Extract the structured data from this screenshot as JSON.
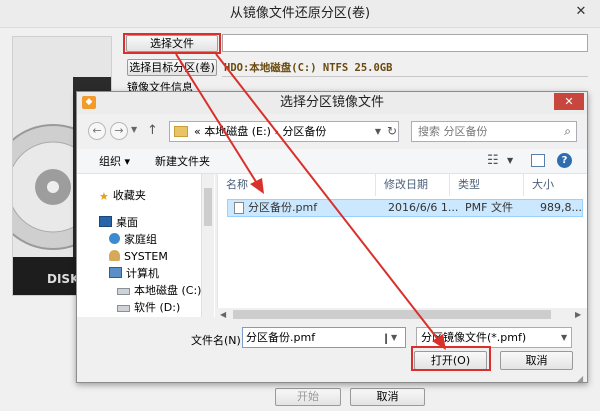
{
  "outer_window": {
    "title": "从镜像文件还原分区(卷)",
    "close_glyph": "✕",
    "select_file_label": "选择文件",
    "file_path_value": "",
    "select_target_label": "选择目标分区(卷)",
    "target_value": "HDO:本地磁盘(C:) NTFS 25.0GB",
    "image_info_label": "镜像文件信息",
    "start_label": "开始",
    "cancel_label": "取消",
    "disk_text": "DISK"
  },
  "dialog": {
    "title": "选择分区镜像文件",
    "close_glyph": "✕",
    "address": {
      "prefix": "«",
      "segments": [
        "本地磁盘 (E:)",
        "分区备份"
      ],
      "separator": "›"
    },
    "search_placeholder": "搜索 分区备份",
    "toolbar": {
      "organize": "组织 ▾",
      "new_folder": "新建文件夹"
    },
    "nav_items": [
      {
        "label": "收藏夹",
        "icon": "star-icon"
      },
      {
        "label": "桌面",
        "icon": "desktop-icon"
      },
      {
        "label": "家庭组",
        "icon": "homegroup-icon"
      },
      {
        "label": "SYSTEM",
        "icon": "user-icon"
      },
      {
        "label": "计算机",
        "icon": "computer-icon"
      },
      {
        "label": "本地磁盘 (C:)",
        "icon": "drive-icon"
      },
      {
        "label": "软件 (D:)",
        "icon": "drive-icon"
      }
    ],
    "columns": {
      "name": "名称",
      "modified": "修改日期",
      "type": "类型",
      "size": "大小"
    },
    "files": [
      {
        "name": "分区备份.pmf",
        "modified": "2016/6/6 1...",
        "type": "PMF 文件",
        "size": "989,8..."
      }
    ],
    "filename_label": "文件名(N):",
    "filename_value": "分区备份.pmf",
    "filetype_value": "分区镜像文件(*.pmf)",
    "open_label": "打开(O)",
    "cancel_label": "取消"
  },
  "colors": {
    "annotation_red": "#d9302c",
    "selection_blue": "#cce8ff",
    "target_text": "#6a4a10"
  }
}
